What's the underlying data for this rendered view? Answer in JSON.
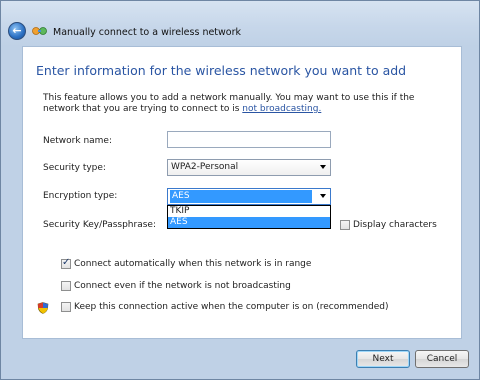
{
  "window": {
    "title": "Manually connect to a wireless network",
    "back_icon": "back-arrow-icon",
    "network_icon": "network-icon"
  },
  "main": {
    "heading": "Enter information for the wireless network you want to add",
    "description": "This feature allows you to add a network manually. You may want to use this if the network that you are trying to connect to is",
    "description_link": "not broadcasting."
  },
  "form": {
    "network_name_label": "Network name:",
    "network_name_value": "",
    "security_type_label": "Security type:",
    "security_type_value": "WPA2-Personal",
    "encryption_type_label": "Encryption type:",
    "encryption_type_value": "AES",
    "encryption_options": [
      "TKIP",
      "AES"
    ],
    "security_key_label": "Security Key/Passphrase:",
    "display_characters_label": "Display characters",
    "display_characters_checked": false
  },
  "options": {
    "connect_auto_label": "Connect automatically when this network is in range",
    "connect_auto_checked": true,
    "connect_even_label": "Connect even if the network is not broadcasting",
    "connect_even_checked": false,
    "keep_active_label": "Keep this connection active when the computer is on (recommended)",
    "keep_active_checked": false,
    "shield_icon": "uac-shield-icon"
  },
  "buttons": {
    "next": "Next",
    "cancel": "Cancel"
  },
  "colors": {
    "heading": "#2a55a3",
    "selection": "#3399ff",
    "frame": "#c7d7ea"
  }
}
